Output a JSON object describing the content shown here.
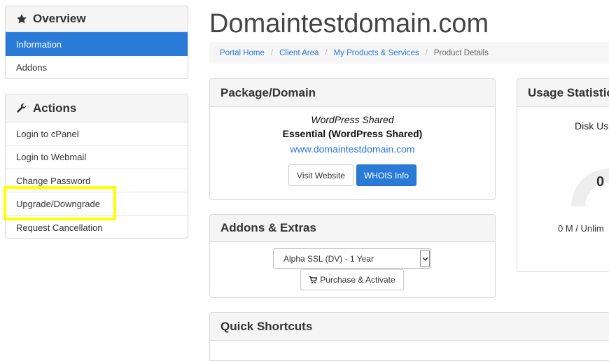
{
  "sidebar": {
    "overview": {
      "title": "Overview",
      "items": [
        {
          "label": "Information",
          "active": true
        },
        {
          "label": "Addons",
          "active": false
        }
      ]
    },
    "actions": {
      "title": "Actions",
      "items": [
        {
          "label": "Login to cPanel"
        },
        {
          "label": "Login to Webmail"
        },
        {
          "label": "Change Password"
        },
        {
          "label": "Upgrade/Downgrade"
        },
        {
          "label": "Request Cancellation"
        }
      ]
    }
  },
  "page": {
    "title": "Domaintestdomain.com"
  },
  "breadcrumb": [
    {
      "label": "Portal Home",
      "link": true
    },
    {
      "label": "Client Area",
      "link": true
    },
    {
      "label": "My Products & Services",
      "link": true
    },
    {
      "label": "Product Details",
      "link": false
    }
  ],
  "package": {
    "title": "Package/Domain",
    "group": "WordPress Shared",
    "product": "Essential (WordPress Shared)",
    "domain": "www.domaintestdomain.com",
    "visit_label": "Visit Website",
    "whois_label": "WHOIS Info"
  },
  "addons": {
    "title": "Addons & Extras",
    "selected": "Alpha SSL (DV) - 1 Year",
    "purchase_label": "Purchase & Activate"
  },
  "usage": {
    "title": "Usage Statistics",
    "disk_label": "Disk Us",
    "value": "0",
    "detail": "0 M / Unlim"
  },
  "shortcuts": {
    "title": "Quick Shortcuts"
  },
  "colors": {
    "accent": "#2a7ad8",
    "highlight": "#ffff00"
  }
}
